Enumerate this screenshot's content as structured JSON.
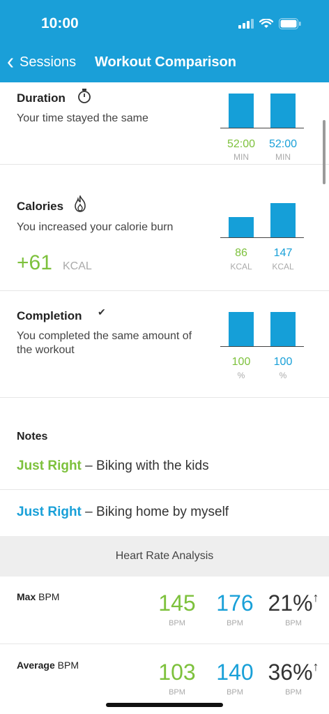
{
  "status_bar": {
    "time": "10:00"
  },
  "nav": {
    "back_label": "Sessions",
    "title": "Workout Comparison"
  },
  "sections": {
    "duration": {
      "title": "Duration",
      "description": "Your time stayed the same",
      "values": [
        {
          "value": "52:00",
          "unit": "MIN",
          "color": "#7dc13c"
        },
        {
          "value": "52:00",
          "unit": "MIN",
          "color": "#19a0d8"
        }
      ],
      "bar_levels": [
        1.0,
        1.0
      ]
    },
    "calories": {
      "title": "Calories",
      "description": "You increased your calorie burn",
      "diff_value": "+61",
      "diff_unit": "KCAL",
      "values": [
        {
          "value": "86",
          "unit": "KCAL",
          "color": "#7dc13c"
        },
        {
          "value": "147",
          "unit": "KCAL",
          "color": "#19a0d8"
        }
      ],
      "bar_levels": [
        0.585,
        1.0
      ]
    },
    "completion": {
      "title": "Completion",
      "description": "You completed the same amount of the workout",
      "values": [
        {
          "value": "100",
          "unit": "%",
          "color": "#7dc13c"
        },
        {
          "value": "100",
          "unit": "%",
          "color": "#19a0d8"
        }
      ],
      "bar_levels": [
        1.0,
        1.0
      ]
    }
  },
  "notes": {
    "title": "Notes",
    "items": [
      {
        "label": "Just Right",
        "text": " – Biking with the kids",
        "color": "#7dc13c"
      },
      {
        "label": "Just Right",
        "text": " – Biking home by myself",
        "color": "#19a0d8"
      }
    ]
  },
  "heart_rate": {
    "header": "Heart Rate Analysis",
    "rows": [
      {
        "label_bold": "Max",
        "label_rest": " BPM",
        "a": "145",
        "b": "176",
        "pct": "21%",
        "unit": "BPM"
      },
      {
        "label_bold": "Average",
        "label_rest": " BPM",
        "a": "103",
        "b": "140",
        "pct": "36%",
        "unit": "BPM"
      }
    ]
  },
  "colors": {
    "header_bg": "#1a9fd8",
    "accent_green": "#7dc13c",
    "accent_blue": "#19a0d8",
    "bar_blue": "#159fd8"
  },
  "icons": [
    "chevron-left-icon",
    "stopwatch-icon",
    "flame-icon",
    "checkmark-icon",
    "arrow-up-icon",
    "signal-icon",
    "wifi-icon",
    "battery-icon"
  ]
}
